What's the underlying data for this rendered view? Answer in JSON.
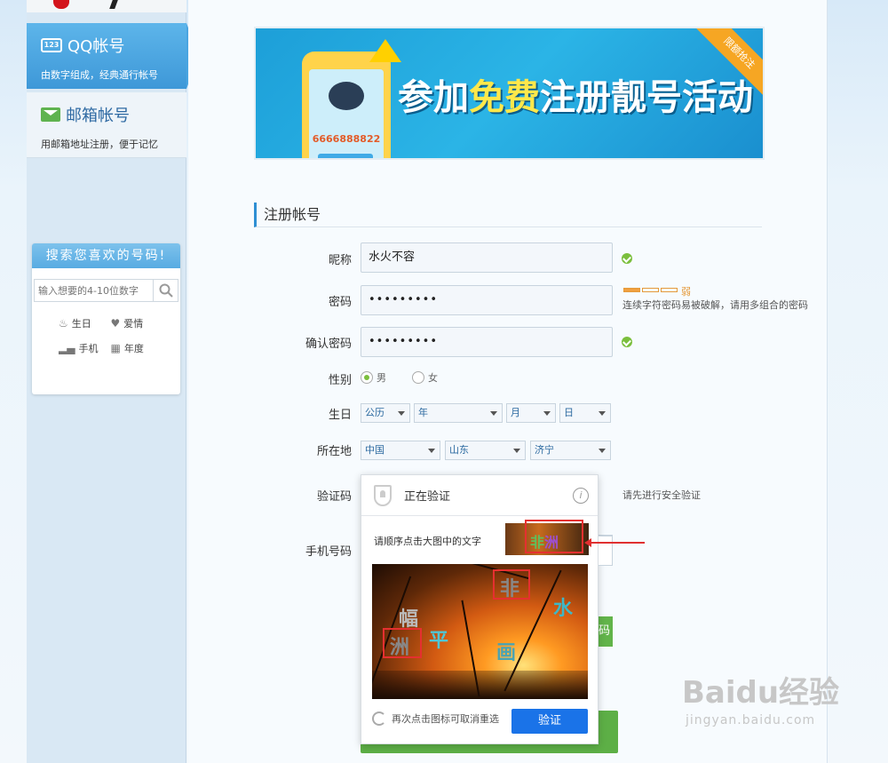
{
  "sidebar": {
    "qq": {
      "icon_text": "123",
      "title": "QQ帐号",
      "subtitle": "由数字组成，经典通行帐号"
    },
    "email": {
      "title": "邮箱帐号",
      "subtitle": "用邮箱地址注册，便于记忆"
    },
    "search": {
      "title": "搜索您喜欢的号码!",
      "placeholder": "输入想要的4-10位数字",
      "tags": [
        "生日",
        "爱情",
        "手机",
        "年度"
      ]
    }
  },
  "banner": {
    "phone_number": "6666888822",
    "text_before": "参加",
    "text_highlight": "免费",
    "text_after": "注册靓号活动",
    "ribbon": "限额抢注"
  },
  "form": {
    "section_title": "注册帐号",
    "nickname": {
      "label": "昵称",
      "value": "水火不容"
    },
    "password": {
      "label": "密码",
      "value": "•••••••••",
      "strength": "弱",
      "hint": "连续字符密码易被破解，请用多组合的密码"
    },
    "confirm": {
      "label": "确认密码",
      "value": "•••••••••"
    },
    "gender": {
      "label": "性别",
      "options": [
        "男",
        "女"
      ],
      "selected": "男"
    },
    "birthday": {
      "label": "生日",
      "calendar": "公历",
      "year": "年",
      "month": "月",
      "day": "日"
    },
    "location": {
      "label": "所在地",
      "country": "中国",
      "province": "山东",
      "city": "济宁"
    },
    "captcha": {
      "label": "验证码",
      "hint": "请先进行安全验证"
    },
    "phone": {
      "label": "手机号码"
    },
    "side_button_fragment": "码"
  },
  "captcha_popup": {
    "title": "正在验证",
    "info_icon": "i",
    "instruction": "请顺序点击大图中的文字",
    "thumb_chars": [
      "非",
      "洲"
    ],
    "image_chars": [
      "幅",
      "洲",
      "平",
      "非",
      "水",
      "画"
    ],
    "footer_hint": "再次点击图标可取消重选",
    "verify_label": "验证"
  },
  "watermark": {
    "main": "Baidu经验",
    "sub": "jingyan.baidu.com"
  }
}
